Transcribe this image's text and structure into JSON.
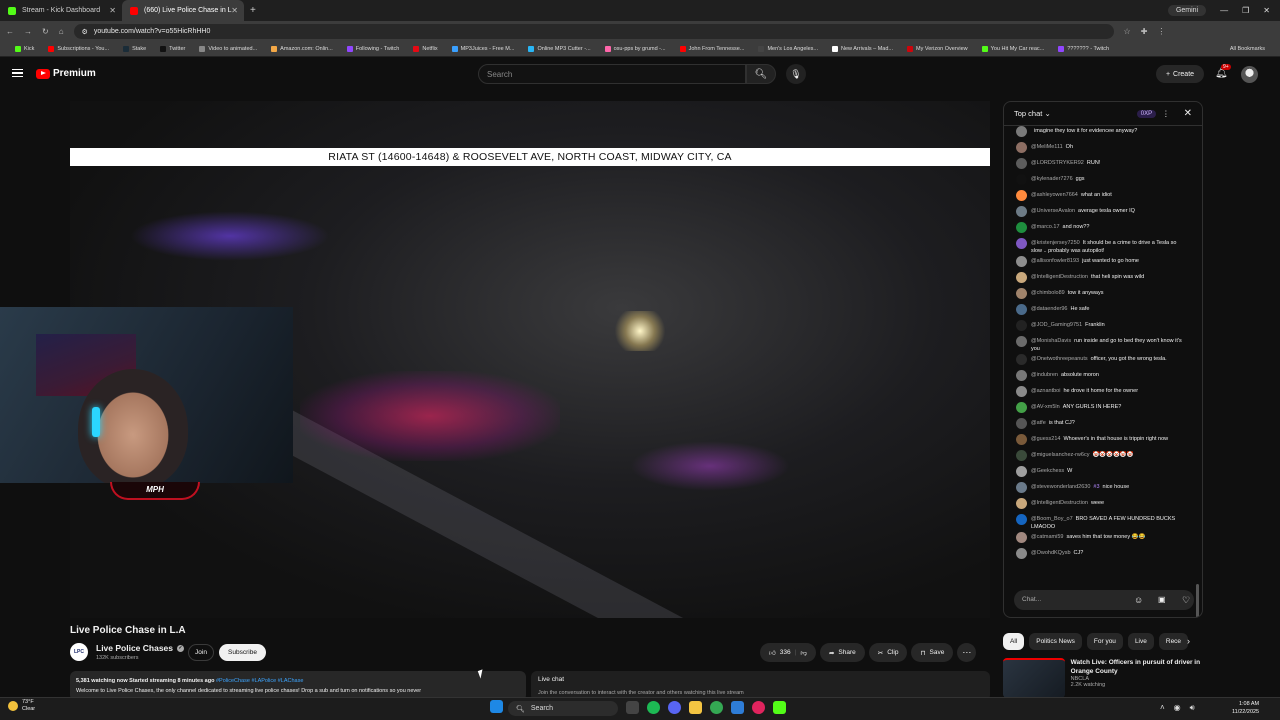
{
  "browser": {
    "tabs": [
      {
        "title": "Stream - Kick Dashboard",
        "color": "#53fc18"
      },
      {
        "title": "(660) Live Police Chase in L",
        "color": "#ff0000"
      }
    ],
    "new_tab": "+",
    "profile": "Gemini",
    "url": "youtube.com/watch?v=o55HicRhHH0",
    "bookmarks": [
      {
        "label": "Kick",
        "color": "#53fc18"
      },
      {
        "label": "Subscriptions - You...",
        "color": "#ff0000"
      },
      {
        "label": "Stake",
        "color": "#1a2c38"
      },
      {
        "label": "Twitter",
        "color": "#111111"
      },
      {
        "label": "Video to animated...",
        "color": "#888888"
      },
      {
        "label": "Amazon.com: Onlin...",
        "color": "#f3a847"
      },
      {
        "label": "Following - Twitch",
        "color": "#9146ff"
      },
      {
        "label": "Netflix",
        "color": "#e50914"
      },
      {
        "label": "MP3Juices - Free M...",
        "color": "#3aa0ff"
      },
      {
        "label": "Online MP3 Cutter -...",
        "color": "#29b6f6"
      },
      {
        "label": "osu-pps by grumd -...",
        "color": "#ff66aa"
      },
      {
        "label": "John From Tennesse...",
        "color": "#ff0000"
      },
      {
        "label": "Men's Los Angeles...",
        "color": "#444444"
      },
      {
        "label": "New Arrivals – Mad...",
        "color": "#ffffff"
      },
      {
        "label": "My Verizon Overview",
        "color": "#cd040b"
      },
      {
        "label": "You Hit My Car reac...",
        "color": "#53fc18"
      },
      {
        "label": "??????? - Twitch",
        "color": "#9146ff"
      }
    ],
    "all_bookmarks": "All Bookmarks"
  },
  "youtube": {
    "logo": "Premium",
    "search_placeholder": "Search",
    "create": "Create",
    "notifications": "9+"
  },
  "video": {
    "caption": "RIATA ST (14600-14648) & ROOSEVELT AVE, NORTH COAST, MIDWAY CITY, CA",
    "overlay_label": "MPH",
    "title": "Live Police Chase in L.A",
    "channel": "Live Police Chases",
    "channel_logo": "LPC",
    "subscribers": "132K subscribers",
    "join": "Join",
    "subscribe": "Subscribe",
    "likes": "336",
    "share": "Share",
    "clip": "Clip",
    "save": "Save",
    "stats": "5,381 watching now  Started streaming 8 minutes ago",
    "tags": "#PoliceChase #LAPolice #LAChase",
    "description": "Welcome to Live Police Chases, the only channel dedicated to streaming live police chases! Drop a sub and turn on notifications so you never",
    "live_chat_label": "Live chat",
    "live_chat_sub": "Join the conversation to interact with the creator and others watching this live stream"
  },
  "chat": {
    "mode": "Top chat",
    "xp": "0XP",
    "input_placeholder": "Chat...",
    "messages": [
      {
        "user": "",
        "text": "imagine they tow it for evidencee anyway?",
        "color": "#7a7a7a"
      },
      {
        "user": "@MeliMe111",
        "text": "Oh",
        "color": "#8d6e63"
      },
      {
        "user": "@LORDSTRYKER92",
        "text": "RUN!",
        "color": "#5c5c5c"
      },
      {
        "user": "@kylenader7276",
        "text": "ggs",
        "color": "#111111"
      },
      {
        "user": "@ashleyowen7664",
        "text": "what an idiot",
        "color": "#ff8a3d"
      },
      {
        "user": "@UniverseAvalon",
        "text": "average tesla owner IQ",
        "color": "#6d7b86"
      },
      {
        "user": "@marco.17",
        "text": "and now??",
        "color": "#1e8e3e"
      },
      {
        "user": "@kristenjersey7250",
        "text": "It should be a crime to drive a Tesla so slow .. probably was autopilot!",
        "color": "#7e57c2"
      },
      {
        "user": "@allisonfowler8193",
        "text": "just wanted to go home",
        "color": "#8d8d8d"
      },
      {
        "user": "@IntelligentDestruction",
        "text": "that heli spin was wild",
        "color": "#c9a87c"
      },
      {
        "user": "@chimbolo89",
        "text": "tow it anyways",
        "color": "#a0836b"
      },
      {
        "user": "@dataender96",
        "text": "He safe",
        "color": "#4a6a8a"
      },
      {
        "user": "@JOD_Gaming9751",
        "text": "Franklin",
        "color": "#222222"
      },
      {
        "user": "@MonishaDavis",
        "text": "run inside and go to bed they won't know it's you",
        "color": "#6b6b6b"
      },
      {
        "user": "@Onetwothreepeanuts",
        "text": "officer, you got the wrong tesla.",
        "color": "#2a2a2a"
      },
      {
        "user": "@indubren",
        "text": "absolute moron",
        "color": "#777777"
      },
      {
        "user": "@aznantboi",
        "text": "he drove it home for the owner",
        "color": "#8a8a8a"
      },
      {
        "user": "@AV-xm5ln",
        "text": "ANY GURLS IN HERE?",
        "color": "#43a047"
      },
      {
        "user": "@atfe",
        "text": "is that CJ?",
        "color": "#555555"
      },
      {
        "user": "@guess214",
        "text": "Whoever's in that house is trippin right now",
        "color": "#7a5a3a"
      },
      {
        "user": "@miguelsanchez-rw6cy",
        "text": "🤡🤡🤡🤡🤡🤡",
        "color": "#3a4a3a"
      },
      {
        "user": "@Geekchess",
        "text": "W",
        "color": "#9e9e9e"
      },
      {
        "user": "@stevewonderland2630",
        "text": "nice house",
        "badge": "#3",
        "color": "#6a7a8a"
      },
      {
        "user": "@IntelligentDestruction",
        "text": "weee",
        "color": "#c9a87c"
      },
      {
        "user": "@Boom_Boy_o7",
        "text": "BRO SAVED A FEW HUNDRED BUCKS LMAOOO",
        "color": "#1565c0"
      },
      {
        "user": "@catmami59",
        "text": "saves him that tow money 😂😂",
        "color": "#a1887f"
      },
      {
        "user": "@OwohdKQysb",
        "text": "CJ?",
        "color": "#8a8a8a"
      }
    ]
  },
  "related": {
    "chips": [
      "All",
      "Politics News",
      "For you",
      "Live",
      "Rece"
    ],
    "item": {
      "title": "Watch Live: Officers in pursuit of driver in Orange County",
      "channel": "NBCLA",
      "views": "2.2K watching"
    }
  },
  "taskbar": {
    "weather_temp": "73°F",
    "weather_cond": "Clear",
    "search": "Search",
    "time": "1:08 AM",
    "date": "11/22/2025"
  }
}
